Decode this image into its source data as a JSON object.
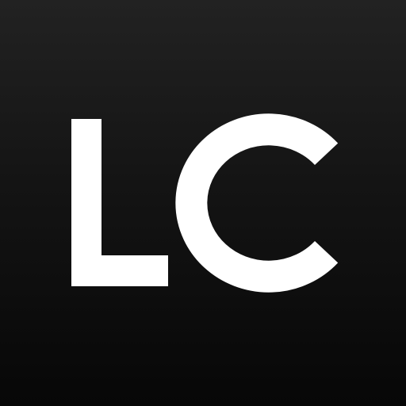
{
  "logo": {
    "text": "LC",
    "letters": [
      "L",
      "C"
    ],
    "foreground_color": "#ffffff",
    "background_top_color": "#222222",
    "background_bottom_color": "#070707"
  }
}
